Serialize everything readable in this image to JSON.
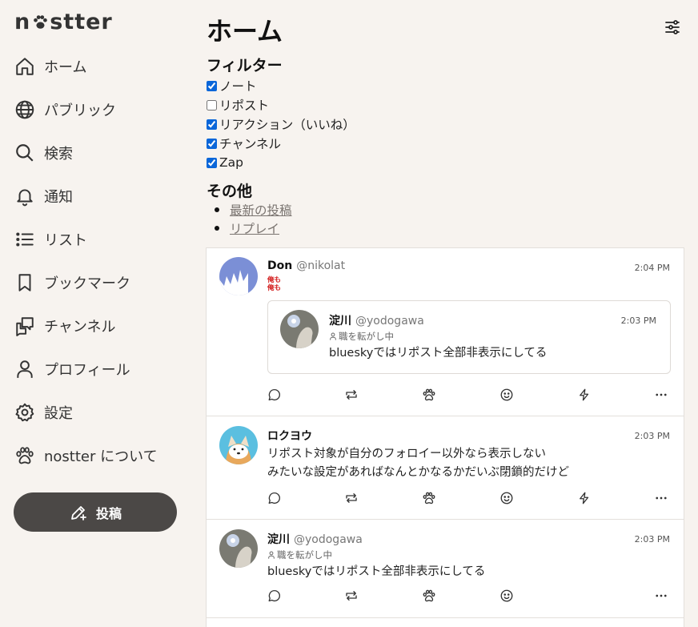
{
  "app": {
    "logo_text": "nostter"
  },
  "sidebar": {
    "items": [
      {
        "label": "ホーム",
        "icon": "home-icon"
      },
      {
        "label": "パブリック",
        "icon": "globe-icon"
      },
      {
        "label": "検索",
        "icon": "search-icon"
      },
      {
        "label": "通知",
        "icon": "bell-icon"
      },
      {
        "label": "リスト",
        "icon": "list-icon"
      },
      {
        "label": "ブックマーク",
        "icon": "bookmark-icon"
      },
      {
        "label": "チャンネル",
        "icon": "channel-icon"
      },
      {
        "label": "プロフィール",
        "icon": "user-icon"
      },
      {
        "label": "設定",
        "icon": "gear-icon"
      },
      {
        "label": "nostter について",
        "icon": "paw-icon"
      }
    ],
    "post_button": "投稿"
  },
  "main": {
    "title": "ホーム",
    "filter_heading": "フィルター",
    "filters": [
      {
        "label": "ノート",
        "checked": true
      },
      {
        "label": "リポスト",
        "checked": false
      },
      {
        "label": "リアクション（いいね）",
        "checked": true
      },
      {
        "label": "チャンネル",
        "checked": true
      },
      {
        "label": "Zap",
        "checked": true
      }
    ],
    "other_heading": "その他",
    "other_links": [
      "最新の投稿",
      "リプレイ"
    ]
  },
  "timeline": {
    "notes": [
      {
        "name": "Don",
        "handle": "@nikolat",
        "time": "2:04 PM",
        "emoji_text": "俺も\n俺も",
        "quote": {
          "name": "淀川",
          "handle": "@yodogawa",
          "time": "2:03 PM",
          "status": "職を転がし中",
          "content": "blueskyではリポスト全部非表示にしてる"
        }
      },
      {
        "name": "ロクヨウ",
        "handle": "",
        "time": "2:03 PM",
        "content_lines": [
          "リポスト対象が自分のフォロイー以外なら表示しない",
          "みたいな設定があればなんとかなるかだいぶ閉鎖的だけど"
        ]
      },
      {
        "name": "淀川",
        "handle": "@yodogawa",
        "time": "2:03 PM",
        "status": "職を転がし中",
        "content": "blueskyではリポスト全部非表示にしてる"
      }
    ]
  },
  "colors": {
    "background": "#f7f3ef",
    "button": "#4b4846",
    "checkbox": "#0a66d9"
  }
}
